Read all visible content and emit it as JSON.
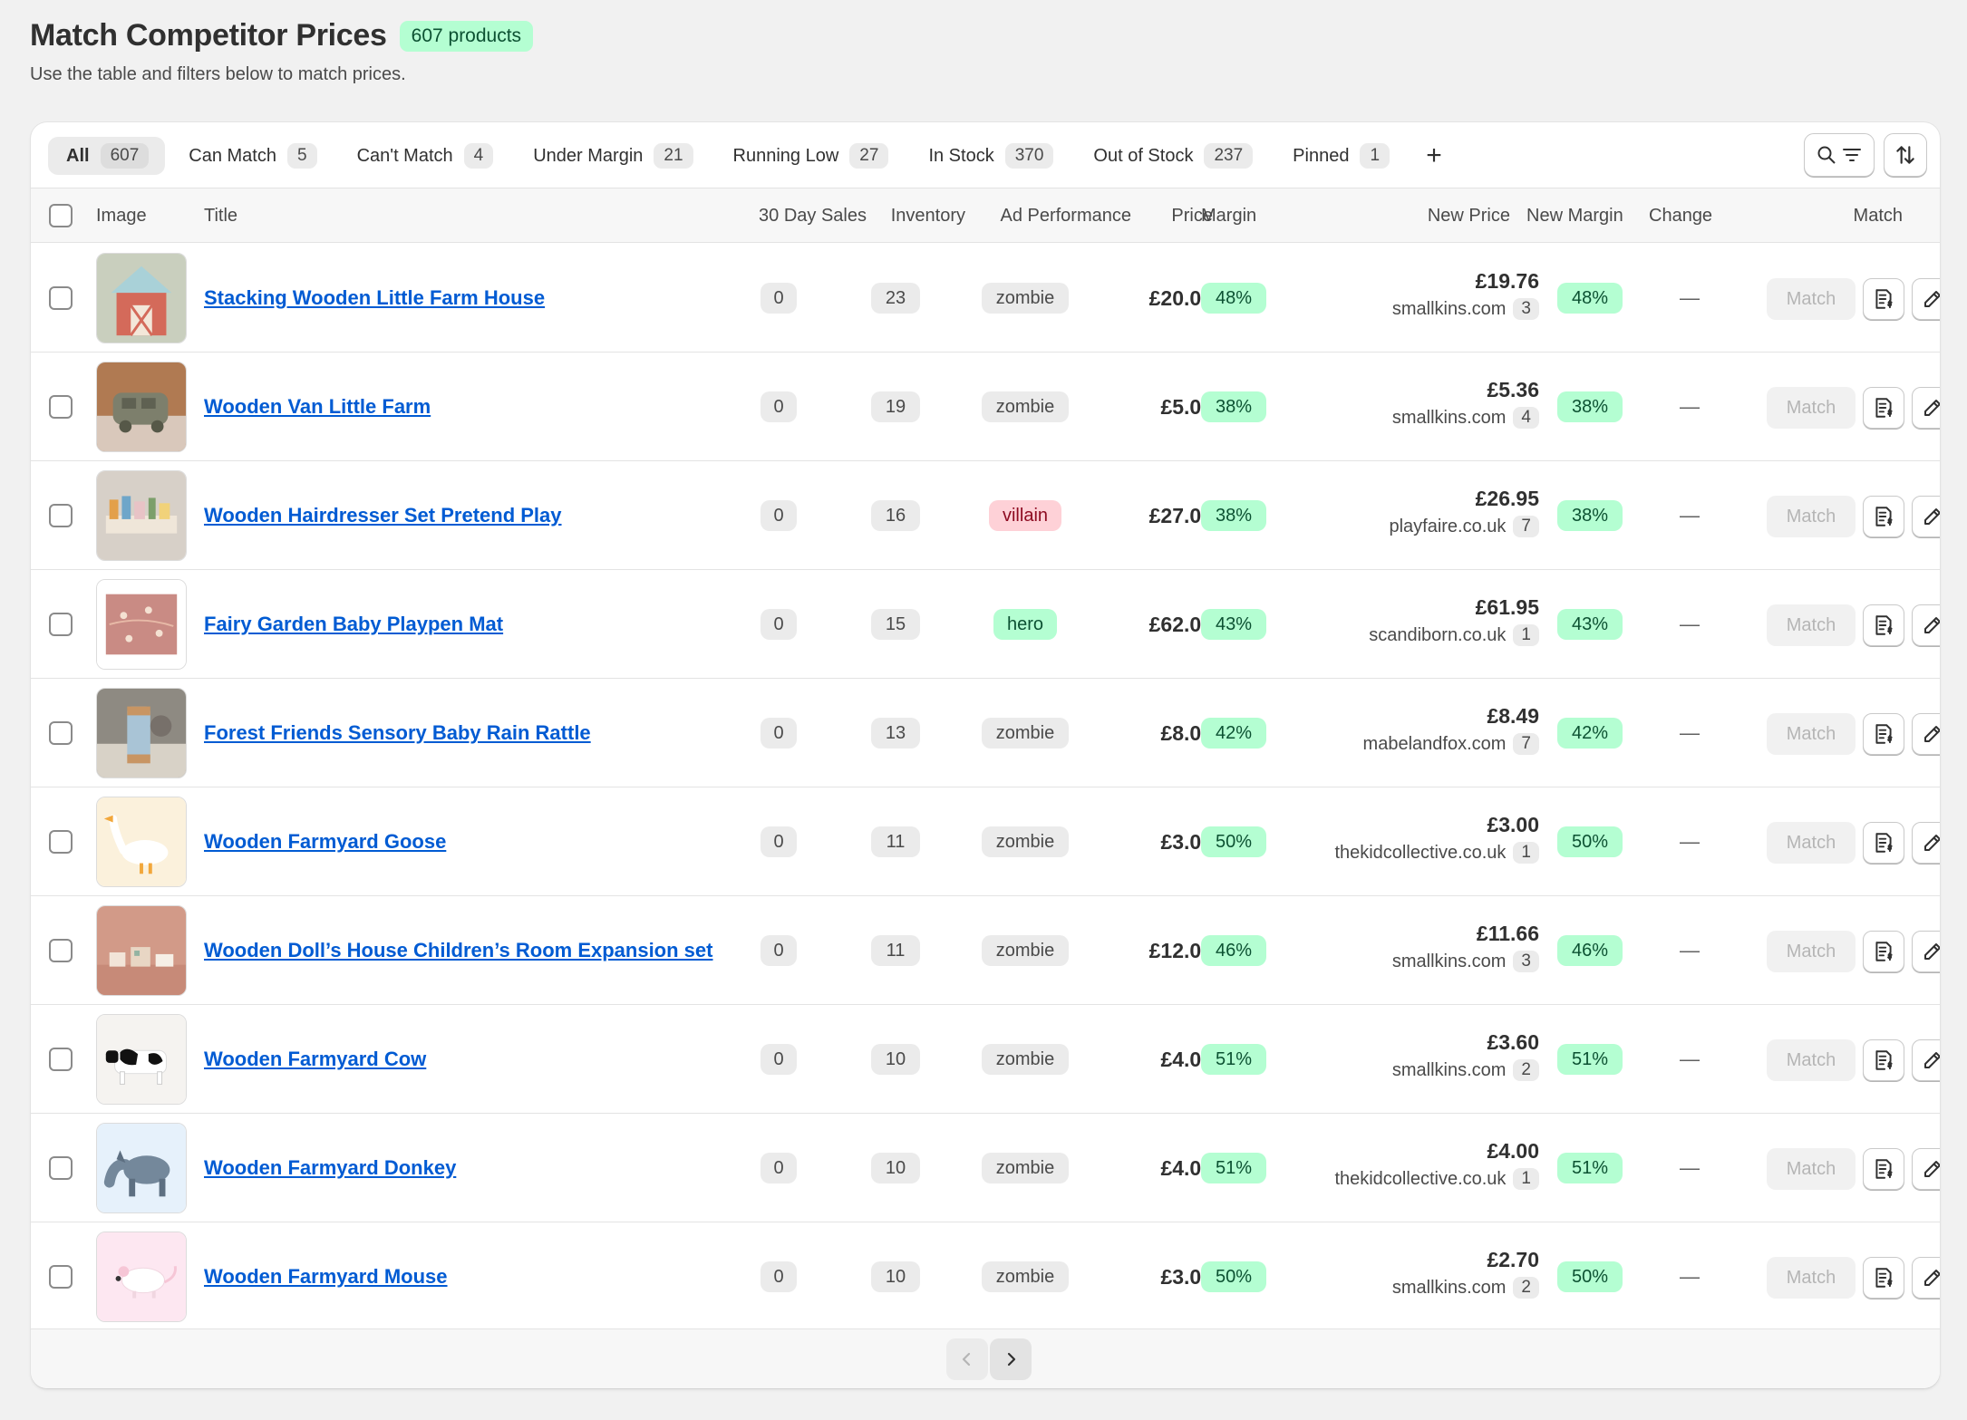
{
  "header": {
    "title": "Match Competitor Prices",
    "product_count": "607 products",
    "subtitle": "Use the table and filters below to match prices."
  },
  "tabs": [
    {
      "label": "All",
      "count": "607",
      "active": true
    },
    {
      "label": "Can Match",
      "count": "5"
    },
    {
      "label": "Can't Match",
      "count": "4"
    },
    {
      "label": "Under Margin",
      "count": "21"
    },
    {
      "label": "Running Low",
      "count": "27"
    },
    {
      "label": "In Stock",
      "count": "370"
    },
    {
      "label": "Out of Stock",
      "count": "237"
    },
    {
      "label": "Pinned",
      "count": "1"
    }
  ],
  "add_tab": "+",
  "columns": {
    "image": "Image",
    "title": "Title",
    "sales": "30 Day Sales",
    "inventory": "Inventory",
    "ad": "Ad Performance",
    "price": "Price",
    "margin": "Margin",
    "new_price": "New Price",
    "new_margin": "New Margin",
    "change": "Change",
    "match": "Match"
  },
  "rows": [
    {
      "title": "Stacking Wooden Little Farm House",
      "sales": "0",
      "inventory": "23",
      "ad": "zombie",
      "price": "£20.00",
      "margin": "48%",
      "new_price": "£19.76",
      "source": "smallkins.com",
      "source_count": "3",
      "new_margin": "48%",
      "change": "—",
      "match": "Match",
      "thumb": "farmhouse"
    },
    {
      "title": "Wooden Van Little Farm",
      "sales": "0",
      "inventory": "19",
      "ad": "zombie",
      "price": "£5.00",
      "margin": "38%",
      "new_price": "£5.36",
      "source": "smallkins.com",
      "source_count": "4",
      "new_margin": "38%",
      "change": "—",
      "match": "Match",
      "thumb": "van"
    },
    {
      "title": "Wooden Hairdresser Set Pretend Play",
      "sales": "0",
      "inventory": "16",
      "ad": "villain",
      "price": "£27.00",
      "margin": "38%",
      "new_price": "£26.95",
      "source": "playfaire.co.uk",
      "source_count": "7",
      "new_margin": "38%",
      "change": "—",
      "match": "Match",
      "thumb": "hairdresser"
    },
    {
      "title": "Fairy Garden Baby Playpen Mat",
      "sales": "0",
      "inventory": "15",
      "ad": "hero",
      "price": "£62.00",
      "margin": "43%",
      "new_price": "£61.95",
      "source": "scandiborn.co.uk",
      "source_count": "1",
      "new_margin": "43%",
      "change": "—",
      "match": "Match",
      "thumb": "mat"
    },
    {
      "title": "Forest Friends Sensory Baby Rain Rattle",
      "sales": "0",
      "inventory": "13",
      "ad": "zombie",
      "price": "£8.00",
      "margin": "42%",
      "new_price": "£8.49",
      "source": "mabelandfox.com",
      "source_count": "7",
      "new_margin": "42%",
      "change": "—",
      "match": "Match",
      "thumb": "rattle"
    },
    {
      "title": "Wooden Farmyard Goose",
      "sales": "0",
      "inventory": "11",
      "ad": "zombie",
      "price": "£3.00",
      "margin": "50%",
      "new_price": "£3.00",
      "source": "thekidcollective.co.uk",
      "source_count": "1",
      "new_margin": "50%",
      "change": "—",
      "match": "Match",
      "thumb": "goose"
    },
    {
      "title": "Wooden Doll’s House Children’s Room Expansion set",
      "sales": "0",
      "inventory": "11",
      "ad": "zombie",
      "price": "£12.00",
      "margin": "46%",
      "new_price": "£11.66",
      "source": "smallkins.com",
      "source_count": "3",
      "new_margin": "46%",
      "change": "—",
      "match": "Match",
      "thumb": "dollhouse"
    },
    {
      "title": "Wooden Farmyard Cow",
      "sales": "0",
      "inventory": "10",
      "ad": "zombie",
      "price": "£4.00",
      "margin": "51%",
      "new_price": "£3.60",
      "source": "smallkins.com",
      "source_count": "2",
      "new_margin": "51%",
      "change": "—",
      "match": "Match",
      "thumb": "cow"
    },
    {
      "title": "Wooden Farmyard Donkey",
      "sales": "0",
      "inventory": "10",
      "ad": "zombie",
      "price": "£4.00",
      "margin": "51%",
      "new_price": "£4.00",
      "source": "thekidcollective.co.uk",
      "source_count": "1",
      "new_margin": "51%",
      "change": "—",
      "match": "Match",
      "thumb": "donkey"
    },
    {
      "title": "Wooden Farmyard Mouse",
      "sales": "0",
      "inventory": "10",
      "ad": "zombie",
      "price": "£3.00",
      "margin": "50%",
      "new_price": "£2.70",
      "source": "smallkins.com",
      "source_count": "2",
      "new_margin": "50%",
      "change": "—",
      "match": "Match",
      "thumb": "mouse"
    }
  ],
  "icons": {
    "search": "search-icon",
    "filter": "filter-icon",
    "sort": "sort-icon",
    "pricelist": "price-list-icon",
    "edit": "pencil-icon",
    "prev": "chevron-left-icon",
    "next": "chevron-right-icon"
  },
  "colors": {
    "link": "#005bd3",
    "success_bg": "#b4fed2",
    "success_text": "#0c5132",
    "critical_bg": "#fed1d7",
    "critical_text": "#8e0b21"
  }
}
